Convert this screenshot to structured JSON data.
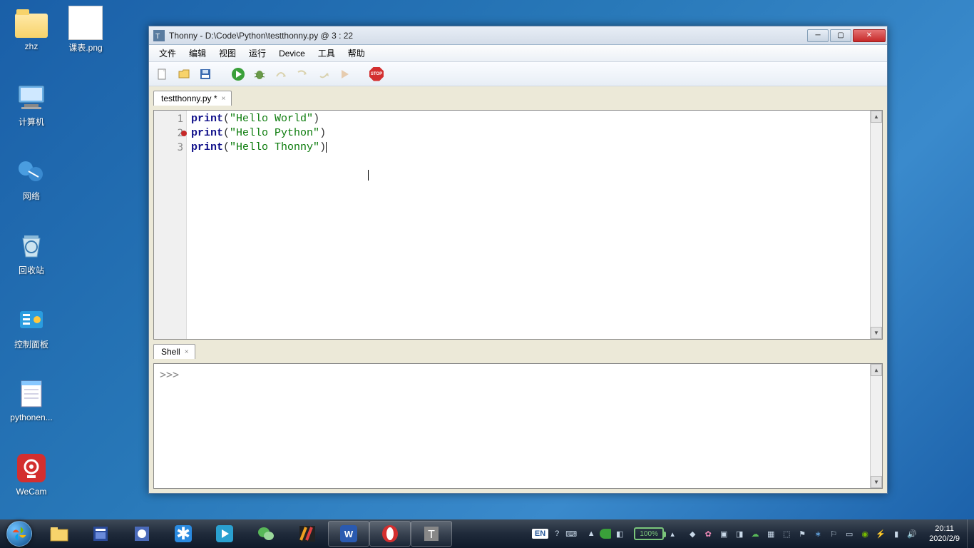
{
  "desktop_icons": {
    "zhz": "zhz",
    "kebiao": "课表.png",
    "computer": "计算机",
    "network": "网络",
    "recycle": "回收站",
    "cpanel": "控制面板",
    "pythonen": "pythonen...",
    "wecam": "WeCam"
  },
  "window": {
    "title": "Thonny  -  D:\\Code\\Python\\testthonny.py  @  3 : 22",
    "menus": [
      "文件",
      "编辑",
      "视图",
      "运行",
      "Device",
      "工具",
      "帮助"
    ],
    "tab_label": "testthonny.py *",
    "shell_tab_label": "Shell",
    "shell_prompt": ">>>",
    "stop_label": "STOP",
    "code": {
      "lines": [
        {
          "n": "1",
          "bp": false,
          "fn": "print",
          "open": "(",
          "str": "\"Hello World\"",
          "close": ")"
        },
        {
          "n": "2",
          "bp": true,
          "fn": "print",
          "open": "(",
          "str": "\"Hello Python\"",
          "close": ")"
        },
        {
          "n": "3",
          "bp": false,
          "fn": "print",
          "open": "(",
          "str": "\"Hello Thonny\"",
          "close": ")"
        }
      ]
    }
  },
  "taskbar": {
    "lang": "EN",
    "battery_pct": "100%",
    "time": "20:11",
    "date": "2020/2/9"
  }
}
